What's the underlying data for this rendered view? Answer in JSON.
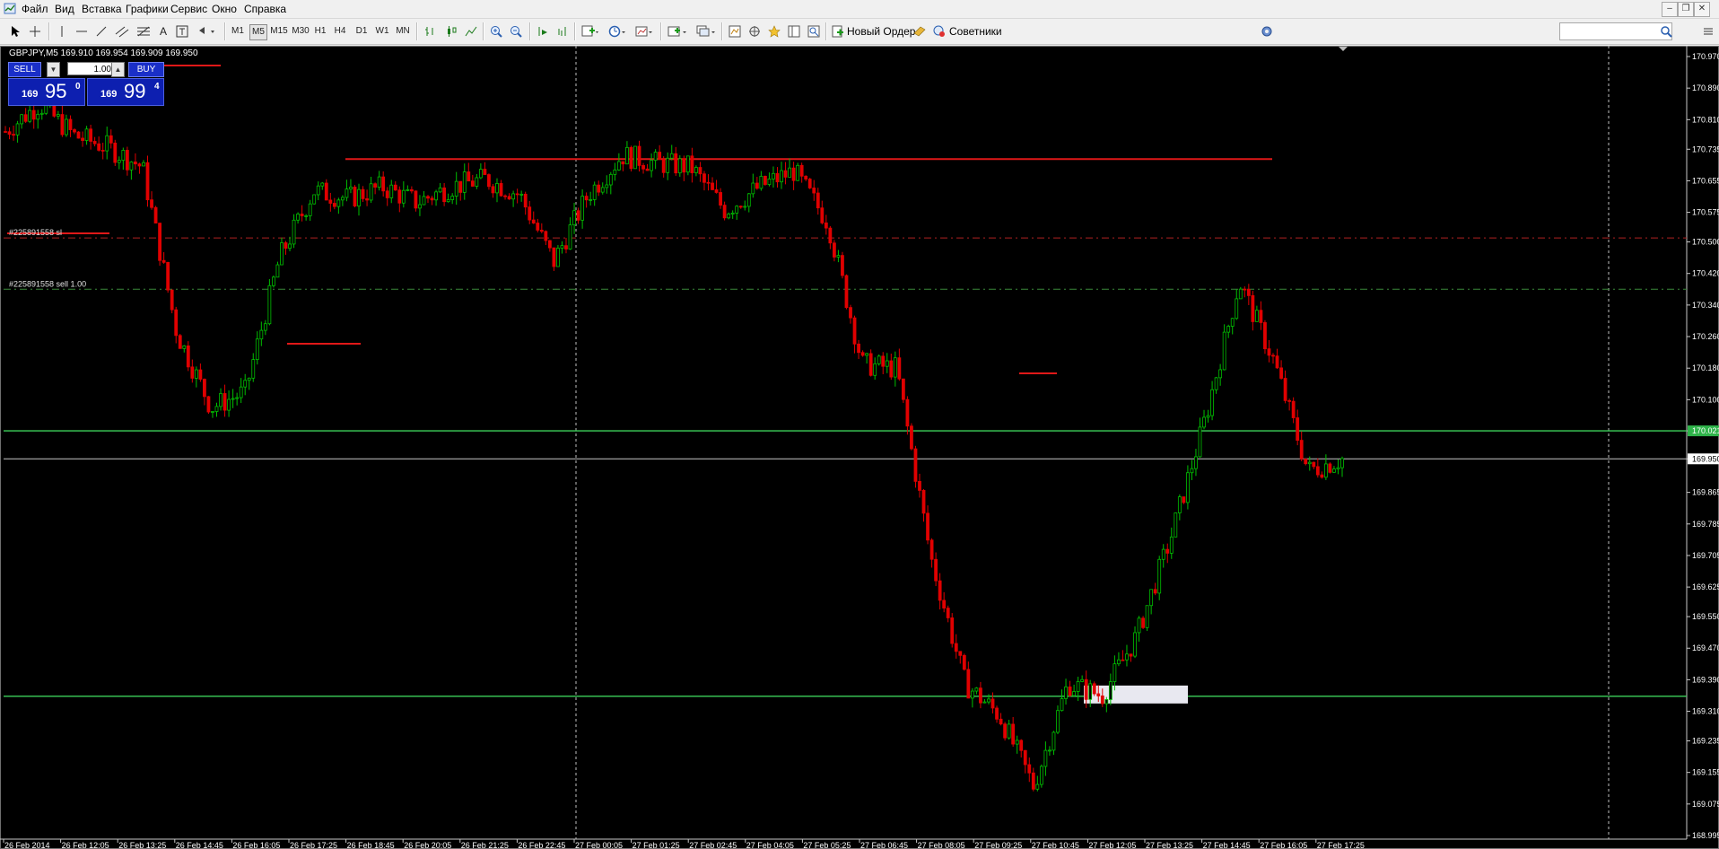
{
  "menu": {
    "items": [
      "Файл",
      "Вид",
      "Вставка",
      "Графики",
      "Сервис",
      "Окно",
      "Справка"
    ]
  },
  "window_controls": {
    "minimize": "–",
    "restore": "❐",
    "close": "✕"
  },
  "toolbar": {
    "timeframes": [
      "M1",
      "M5",
      "M15",
      "M30",
      "H1",
      "H4",
      "D1",
      "W1",
      "MN"
    ],
    "active_timeframe": "M5",
    "new_order_label": "Новый Ордер",
    "advisors_label": "Советники",
    "icons": [
      "cursor-icon",
      "crosshair-icon",
      "vertical-line-icon",
      "horizontal-line-icon",
      "trendline-icon",
      "channel-icon",
      "fibonacci-icon",
      "text-icon",
      "text-label-icon",
      "shapes-icon",
      "bar-chart-icon",
      "candlestick-icon",
      "line-chart-icon",
      "zoom-in-icon",
      "zoom-out-icon",
      "auto-scroll-icon",
      "chart-shift-icon",
      "indicators-icon",
      "periods-icon",
      "templates-icon",
      "new-chart-icon",
      "profiles-icon",
      "market-watch-icon",
      "navigator-icon",
      "favorites-icon",
      "data-window-icon",
      "strategy-tester-icon",
      "new-order-icon",
      "advisors-icon",
      "settings-icon",
      "search-icon"
    ]
  },
  "chart": {
    "symbol_header": "GBPJPY,M5  169.910 169.954 169.909 169.950",
    "one_click": {
      "sell_label": "SELL",
      "buy_label": "BUY",
      "lots": "1.00",
      "sell_price_small": "169",
      "sell_price_big": "95",
      "sell_price_sup": "0",
      "buy_price_small": "169",
      "buy_price_big": "99",
      "buy_price_sup": "4"
    },
    "order_labels": {
      "sl": "#225891558 sl",
      "entry": "#225891558 sell 1.00"
    },
    "price_axis": [
      "170.970",
      "170.890",
      "170.810",
      "170.735",
      "170.655",
      "170.575",
      "170.500",
      "170.420",
      "170.340",
      "170.260",
      "170.180",
      "170.100",
      "170.021",
      "169.950",
      "169.865",
      "169.785",
      "169.705",
      "169.625",
      "169.550",
      "169.470",
      "169.390",
      "169.310",
      "169.235",
      "169.155",
      "169.075",
      "168.995"
    ],
    "highlight_prices": {
      "upper": "170.021",
      "lower": "169.348",
      "bid": "169.950"
    },
    "time_axis": [
      "26 Feb 2014",
      "26 Feb 12:05",
      "26 Feb 13:25",
      "26 Feb 14:45",
      "26 Feb 16:05",
      "26 Feb 17:25",
      "26 Feb 18:45",
      "26 Feb 20:05",
      "26 Feb 21:25",
      "26 Feb 22:45",
      "27 Feb 00:05",
      "27 Feb 01:25",
      "27 Feb 02:45",
      "27 Feb 04:05",
      "27 Feb 05:25",
      "27 Feb 06:45",
      "27 Feb 08:05",
      "27 Feb 09:25",
      "27 Feb 10:45",
      "27 Feb 12:05",
      "27 Feb 13:25",
      "27 Feb 14:45",
      "27 Feb 16:05",
      "27 Feb 17:25"
    ],
    "colors": {
      "bull": "#00c000",
      "bear": "#e00000",
      "green_level": "#3ccf5a",
      "red_level": "#e01818",
      "background": "#000000"
    }
  },
  "chart_data": {
    "type": "candlestick",
    "symbol": "GBPJPY",
    "timeframe": "M5",
    "ylim": [
      168.995,
      170.97
    ],
    "y_ticks": [
      170.97,
      170.89,
      170.81,
      170.735,
      170.655,
      170.575,
      170.5,
      170.42,
      170.34,
      170.26,
      170.18,
      170.1,
      170.021,
      169.95,
      169.865,
      169.785,
      169.705,
      169.625,
      169.55,
      169.47,
      169.39,
      169.31,
      169.235,
      169.155,
      169.075,
      168.995
    ],
    "x": [
      "26 Feb 2014",
      "26 Feb 12:05",
      "26 Feb 13:25",
      "26 Feb 14:45",
      "26 Feb 16:05",
      "26 Feb 17:25",
      "26 Feb 18:45",
      "26 Feb 20:05",
      "26 Feb 21:25",
      "26 Feb 22:45",
      "27 Feb 00:05",
      "27 Feb 01:25",
      "27 Feb 02:45",
      "27 Feb 04:05",
      "27 Feb 05:25",
      "27 Feb 06:45",
      "27 Feb 08:05",
      "27 Feb 09:25",
      "27 Feb 10:45",
      "27 Feb 12:05",
      "27 Feb 13:25",
      "27 Feb 14:45",
      "27 Feb 16:05",
      "27 Feb 17:25"
    ],
    "close_path": [
      170.78,
      170.85,
      170.77,
      170.74,
      170.69,
      170.27,
      170.08,
      170.12,
      170.46,
      170.63,
      170.61,
      170.64,
      170.6,
      170.64,
      170.66,
      170.62,
      170.45,
      170.62,
      170.72,
      170.7,
      170.69,
      170.58,
      170.64,
      170.68,
      170.55,
      170.19,
      170.18,
      169.7,
      169.38,
      169.3,
      169.12,
      169.38,
      169.35,
      169.5,
      169.75,
      170.05,
      170.4,
      170.2,
      169.92,
      169.95
    ],
    "levels": {
      "green_upper": 170.021,
      "green_lower": 169.348,
      "bid": 169.95,
      "sl": 170.51,
      "entry": 170.38,
      "resistance": 170.71
    },
    "grid": false
  }
}
